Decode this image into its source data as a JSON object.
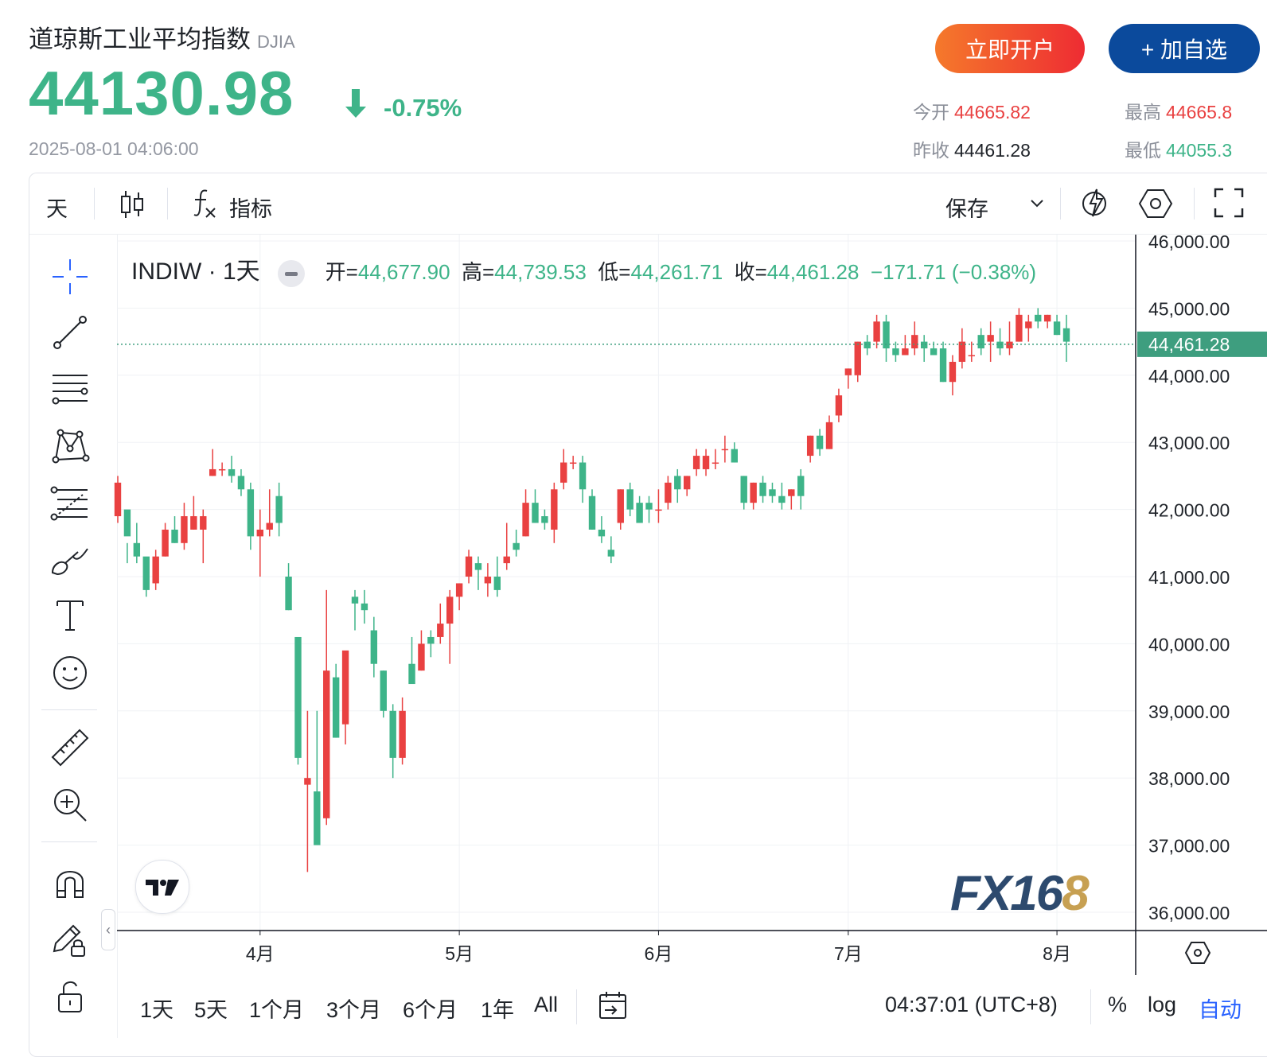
{
  "header": {
    "title": "道琼斯工业平均指数",
    "ticker": "DJIA",
    "price": "44130.98",
    "change_pct": "-0.75%",
    "timestamp": "2025-08-01 04:06:00",
    "open_account_label": "立即开户",
    "add_watch_label": "+ 加自选",
    "stats": {
      "open_label": "今开",
      "open_value": "44665.82",
      "high_label": "最高",
      "high_value": "44665.8",
      "prev_close_label": "昨收",
      "prev_close_value": "44461.28",
      "low_label": "最低",
      "low_value": "44055.3"
    },
    "colors": {
      "up": "#e94141",
      "down": "#3eb489",
      "accent": "#0b4a9c"
    }
  },
  "toolbar": {
    "interval": "天",
    "candle_icon": "candlestick-icon",
    "fx_icon": "function-icon",
    "indicators_label": "指标",
    "save_label": "保存",
    "icons": [
      "chevron-down-icon",
      "lightning-icon",
      "settings-hexagon-icon",
      "fullscreen-icon"
    ]
  },
  "left_tools": [
    "crosshair-icon",
    "trend-line-icon",
    "horizontal-lines-icon",
    "pattern-icon",
    "fib-icon",
    "brush-icon",
    "text-icon",
    "emoji-icon",
    "ruler-icon",
    "zoom-in-icon",
    "magnet-icon",
    "lock-pencil-icon",
    "unlock-icon"
  ],
  "legend": {
    "symbol": "INDIW · 1天",
    "open_label": "开=",
    "open": "44,677.90",
    "high_label": "高=",
    "high": "44,739.53",
    "low_label": "低=",
    "low": "44,261.71",
    "close_label": "收=",
    "close": "44,461.28",
    "change": "−171.71 (−0.38%)"
  },
  "watermark": {
    "brand": "FX16",
    "brand_tail": "8"
  },
  "bottom": {
    "ranges": [
      "1天",
      "5天",
      "1个月",
      "3个月",
      "6个月",
      "1年",
      "All"
    ],
    "clock": "04:37:01 (UTC+8)",
    "pct_label": "%",
    "log_label": "log",
    "auto_label": "自动"
  },
  "chart_data": {
    "type": "candlestick",
    "y_axis_ticks": [
      46000,
      45000,
      44000,
      43000,
      42000,
      41000,
      40000,
      39000,
      38000,
      37000,
      36000
    ],
    "y_axis_labels": [
      "46,000.00",
      "45,000.00",
      "44,000.00",
      "43,000.00",
      "42,000.00",
      "41,000.00",
      "40,000.00",
      "39,000.00",
      "38,000.00",
      "37,000.00",
      "36,000.00"
    ],
    "ylim": [
      35750,
      46000
    ],
    "last_price": 44461.28,
    "last_price_label": "44,461.28",
    "x_month_labels": [
      "4月",
      "5月",
      "6月",
      "7月",
      "8月"
    ],
    "x_month_index": [
      15,
      36,
      57,
      77,
      99
    ],
    "candles": [
      [
        41900,
        42500,
        41800,
        42400
      ],
      [
        42000,
        41500,
        41200,
        41600
      ],
      [
        41500,
        41800,
        41200,
        41300
      ],
      [
        41300,
        41000,
        40700,
        40800
      ],
      [
        40900,
        41400,
        40800,
        41300
      ],
      [
        41300,
        41800,
        41300,
        41700
      ],
      [
        41700,
        41900,
        41500,
        41500
      ],
      [
        41500,
        42100,
        41400,
        41900
      ],
      [
        41700,
        42200,
        41700,
        41900
      ],
      [
        41700,
        42000,
        41200,
        41900
      ],
      [
        42500,
        42900,
        42500,
        42600
      ],
      [
        42600,
        42700,
        42500,
        42600
      ],
      [
        42600,
        42800,
        42400,
        42500
      ],
      [
        42500,
        42600,
        42200,
        42300
      ],
      [
        42300,
        42400,
        41400,
        41600
      ],
      [
        41600,
        42000,
        41000,
        41700
      ],
      [
        41700,
        42300,
        41600,
        41800
      ],
      [
        42200,
        42400,
        41600,
        41800
      ],
      [
        41000,
        41200,
        40500,
        40500
      ],
      [
        40100,
        40100,
        38200,
        38300
      ],
      [
        37900,
        39000,
        36600,
        38000
      ],
      [
        37800,
        39000,
        37200,
        37000
      ],
      [
        37400,
        40800,
        37300,
        39600
      ],
      [
        39500,
        39700,
        38600,
        38600
      ],
      [
        38800,
        39800,
        38500,
        39900
      ],
      [
        40700,
        40800,
        40200,
        40600
      ],
      [
        40600,
        40800,
        40300,
        40500
      ],
      [
        40200,
        40400,
        39500,
        39700
      ],
      [
        39600,
        39600,
        38900,
        39000
      ],
      [
        39000,
        39100,
        38000,
        38300
      ],
      [
        38300,
        39200,
        38200,
        39000
      ],
      [
        39700,
        40100,
        39500,
        39400
      ],
      [
        39600,
        40200,
        39600,
        40000
      ],
      [
        40100,
        40200,
        39800,
        40000
      ],
      [
        40100,
        40600,
        40000,
        40300
      ],
      [
        40300,
        40800,
        39700,
        40700
      ],
      [
        40700,
        40900,
        40500,
        40900
      ],
      [
        41000,
        41400,
        40900,
        41300
      ],
      [
        41200,
        41300,
        40800,
        41100
      ],
      [
        40900,
        41200,
        40700,
        41000
      ],
      [
        41000,
        41300,
        40700,
        40800
      ],
      [
        41200,
        41800,
        41100,
        41300
      ],
      [
        41500,
        41700,
        41300,
        41400
      ],
      [
        41600,
        42300,
        41600,
        42100
      ],
      [
        42100,
        42300,
        41800,
        41800
      ],
      [
        41900,
        42000,
        41700,
        41800
      ],
      [
        41700,
        42400,
        41500,
        42300
      ],
      [
        42400,
        42900,
        42300,
        42700
      ],
      [
        42700,
        42800,
        42600,
        42700
      ],
      [
        42700,
        42800,
        42100,
        42300
      ],
      [
        42200,
        42300,
        41700,
        41700
      ],
      [
        41700,
        41900,
        41500,
        41600
      ],
      [
        41400,
        41600,
        41200,
        41300
      ],
      [
        41800,
        42300,
        41700,
        42300
      ],
      [
        42300,
        42400,
        41900,
        42000
      ],
      [
        42100,
        42200,
        41800,
        41800
      ],
      [
        42100,
        42200,
        41800,
        42000
      ],
      [
        42000,
        42300,
        41800,
        42000
      ],
      [
        42100,
        42500,
        42000,
        42400
      ],
      [
        42500,
        42600,
        42100,
        42300
      ],
      [
        42300,
        42500,
        42200,
        42500
      ],
      [
        42600,
        42900,
        42500,
        42800
      ],
      [
        42600,
        42900,
        42500,
        42800
      ],
      [
        42700,
        42900,
        42600,
        42700
      ],
      [
        42900,
        43100,
        42700,
        42900
      ],
      [
        42900,
        43000,
        42700,
        42700
      ],
      [
        42500,
        42500,
        42000,
        42100
      ],
      [
        42100,
        42400,
        42000,
        42400
      ],
      [
        42400,
        42500,
        42100,
        42200
      ],
      [
        42300,
        42400,
        42100,
        42200
      ],
      [
        42200,
        42400,
        42000,
        42100
      ],
      [
        42200,
        42300,
        42000,
        42300
      ],
      [
        42500,
        42600,
        42000,
        42200
      ],
      [
        42800,
        43100,
        42700,
        43100
      ],
      [
        43100,
        43200,
        42800,
        42900
      ],
      [
        42900,
        43400,
        42900,
        43300
      ],
      [
        43400,
        43800,
        43300,
        43700
      ],
      [
        44000,
        44100,
        43800,
        44100
      ],
      [
        44000,
        44500,
        43900,
        44500
      ],
      [
        44500,
        44600,
        44300,
        44400
      ],
      [
        44500,
        44900,
        44400,
        44800
      ],
      [
        44800,
        44900,
        44200,
        44400
      ],
      [
        44400,
        44500,
        44200,
        44300
      ],
      [
        44300,
        44600,
        44300,
        44400
      ],
      [
        44400,
        44800,
        44300,
        44600
      ],
      [
        44500,
        44600,
        44200,
        44400
      ],
      [
        44400,
        44500,
        44300,
        44300
      ],
      [
        44400,
        44500,
        43900,
        43900
      ],
      [
        43900,
        44300,
        43700,
        44200
      ],
      [
        44200,
        44700,
        44100,
        44500
      ],
      [
        44300,
        44500,
        44200,
        44300
      ],
      [
        44600,
        44700,
        44300,
        44400
      ],
      [
        44500,
        44800,
        44200,
        44600
      ],
      [
        44500,
        44700,
        44300,
        44400
      ],
      [
        44400,
        44800,
        44300,
        44500
      ],
      [
        44500,
        45000,
        44500,
        44900
      ],
      [
        44700,
        44900,
        44500,
        44800
      ],
      [
        44900,
        45000,
        44700,
        44800
      ],
      [
        44800,
        44900,
        44700,
        44900
      ],
      [
        44800,
        44900,
        44600,
        44600
      ],
      [
        44700,
        44900,
        44200,
        44500
      ]
    ]
  }
}
